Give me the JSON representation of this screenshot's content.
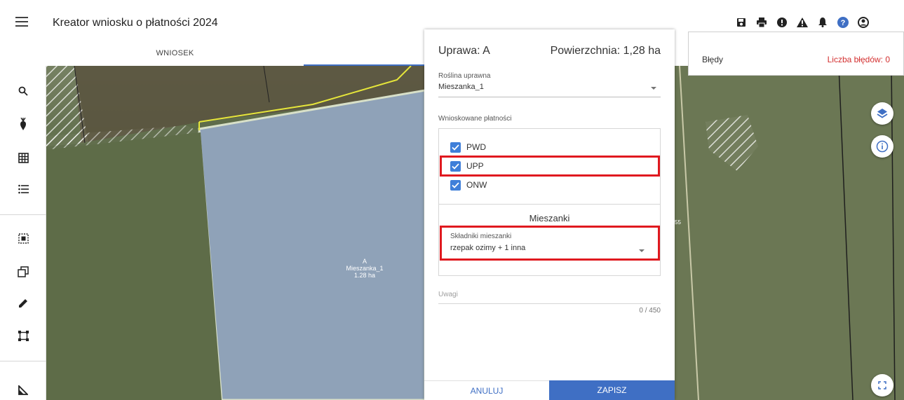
{
  "app": {
    "title": "Kreator wniosku o płatności 2024"
  },
  "tabs": {
    "wniosek": "WNIOSEK"
  },
  "top_icons": [
    "save-icon",
    "print-icon",
    "alert-circle-icon",
    "warning-icon",
    "bell-icon",
    "help-icon",
    "account-icon"
  ],
  "left_tools": [
    "search-icon",
    "crop-icon",
    "grid-icon",
    "list-icon",
    "select-area-icon",
    "copy-icon",
    "pencil-icon",
    "bounding-box-icon",
    "measure-icon"
  ],
  "panel": {
    "crop_title": "Uprawa: A",
    "area": "Powierzchnia: 1,28 ha",
    "plant_label": "Roślina uprawna",
    "plant_value": "Mieszanka_1",
    "payments_label": "Wnioskowane płatności",
    "payments": [
      {
        "label": "PWD",
        "checked": true
      },
      {
        "label": "UPP",
        "checked": true
      },
      {
        "label": "ONW",
        "checked": true
      }
    ],
    "mix_title": "Mieszanki",
    "mix_label": "Składniki mieszanki",
    "mix_value": "rzepak ozimy + 1 inna",
    "notes_label": "Uwagi",
    "notes_count": "0 / 450",
    "cancel": "ANULUJ",
    "save": "ZAPISZ"
  },
  "errors": {
    "label": "Błędy",
    "count": "Liczba błędów: 0"
  },
  "parcel": {
    "line1": "A",
    "line2": "Mieszanka_1",
    "line3": "1.28 ha"
  },
  "map_side_label": "55",
  "colors": {
    "accent": "#3f6fc4",
    "checkbox": "#3f7fd9",
    "highlight": "#e0191f",
    "error_text": "#d32f2f"
  }
}
